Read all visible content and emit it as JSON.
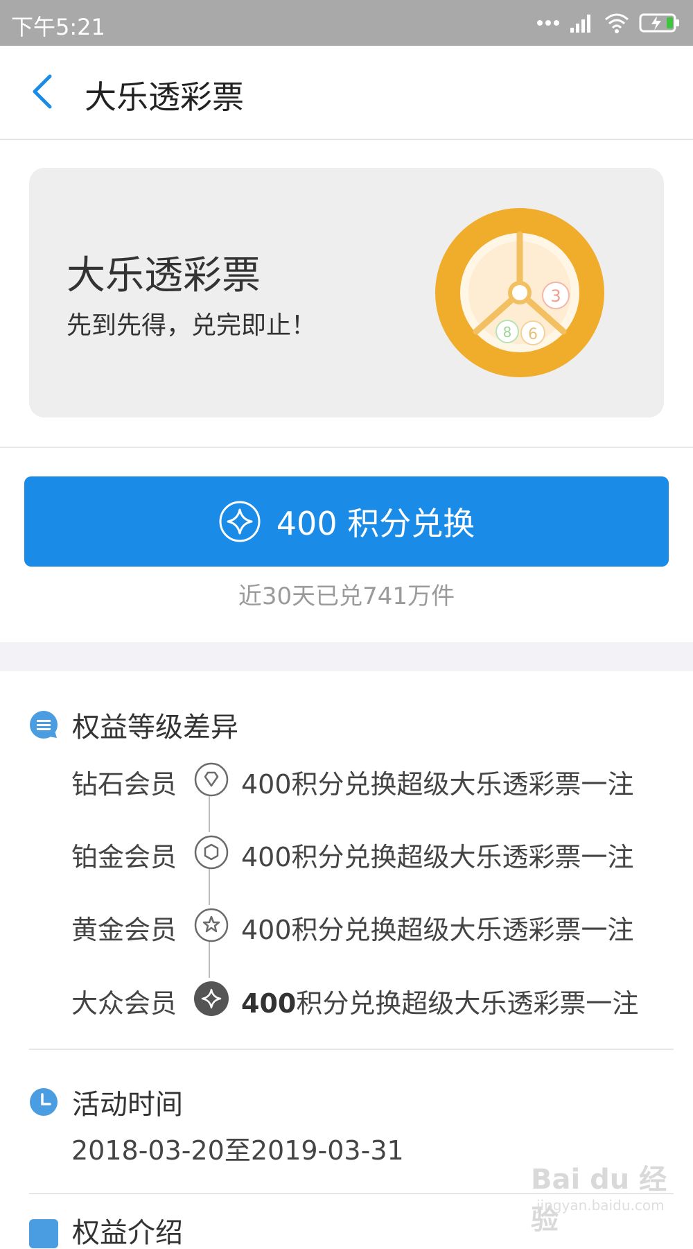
{
  "status_bar": {
    "time": "下午5:21"
  },
  "nav": {
    "title": "大乐透彩票"
  },
  "banner": {
    "title": "大乐透彩票",
    "subtitle": "先到先得，兑完即止！",
    "ball_numbers": [
      "3",
      "8",
      "6"
    ]
  },
  "exchange": {
    "button_label": "400 积分兑换",
    "note": "近30天已兑741万件"
  },
  "benefits": {
    "heading": "权益等级差异",
    "tiers": [
      {
        "name": "钻石会员",
        "icon": "diamond-icon",
        "points": "400",
        "desc": "积分兑换超级大乐透彩票一注",
        "current": false
      },
      {
        "name": "铂金会员",
        "icon": "hexagon-icon",
        "points": "400",
        "desc": "积分兑换超级大乐透彩票一注",
        "current": false
      },
      {
        "name": "黄金会员",
        "icon": "star-icon",
        "points": "400",
        "desc": "积分兑换超级大乐透彩票一注",
        "current": false
      },
      {
        "name": "大众会员",
        "icon": "sparkle-icon",
        "points": "400",
        "desc": "积分兑换超级大乐透彩票一注",
        "current": true
      }
    ]
  },
  "activity_time": {
    "heading": "活动时间",
    "value": "2018-03-20至2019-03-31"
  },
  "next_section": {
    "heading": "权益介绍"
  },
  "watermark": {
    "brand": "Bai du 经验",
    "url": "jingyan.baidu.com"
  },
  "colors": {
    "accent": "#1a8ce8",
    "section_icon": "#4a9de0",
    "banner_orange": "#f0ad2c",
    "status_bar": "#a9a9a9"
  }
}
